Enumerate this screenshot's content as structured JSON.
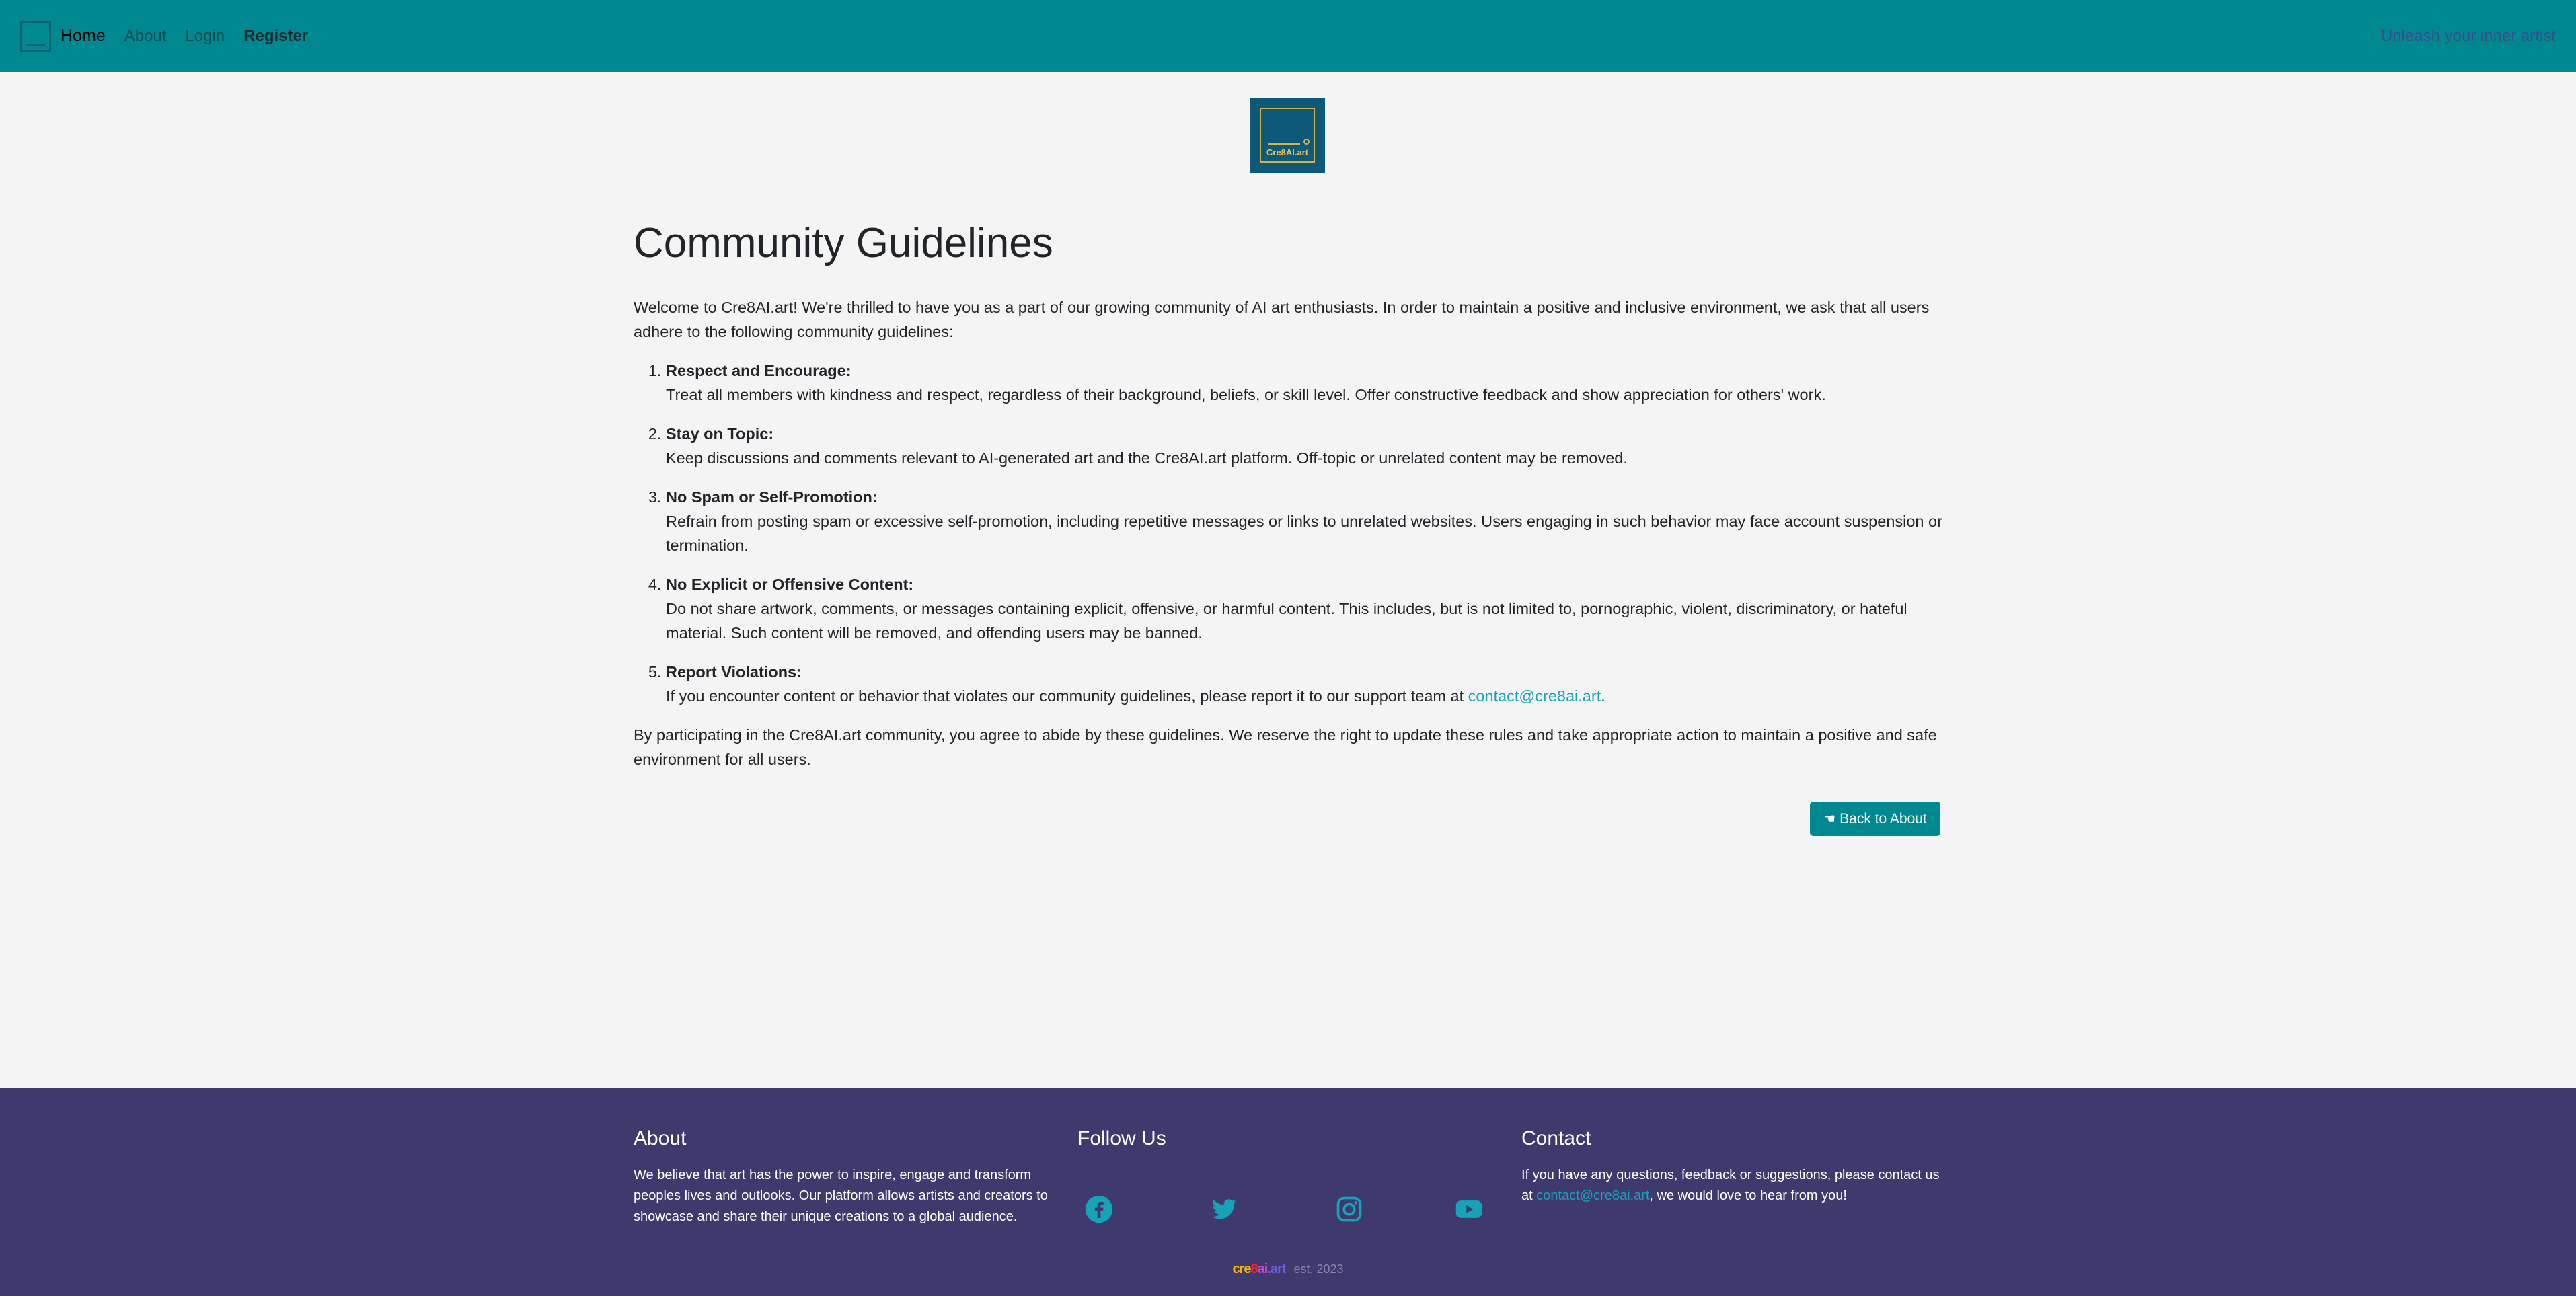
{
  "nav": {
    "home": "Home",
    "about": "About",
    "login": "Login",
    "register": "Register",
    "tagline": "Unleash your inner artist"
  },
  "brand": {
    "logo_text": "Cre8AI.art"
  },
  "main": {
    "title": "Community Guidelines",
    "intro": "Welcome to Cre8AI.art! We're thrilled to have you as a part of our growing community of AI art enthusiasts. In order to maintain a positive and inclusive environment, we ask that all users adhere to the following community guidelines:",
    "guidelines": [
      {
        "title": "Respect and Encourage:",
        "text": "Treat all members with kindness and respect, regardless of their background, beliefs, or skill level. Offer constructive feedback and show appreciation for others' work."
      },
      {
        "title": "Stay on Topic:",
        "text": "Keep discussions and comments relevant to AI-generated art and the Cre8AI.art platform. Off-topic or unrelated content may be removed."
      },
      {
        "title": "No Spam or Self-Promotion:",
        "text": "Refrain from posting spam or excessive self-promotion, including repetitive messages or links to unrelated websites. Users engaging in such behavior may face account suspension or termination."
      },
      {
        "title": "No Explicit or Offensive Content:",
        "text": "Do not share artwork, comments, or messages containing explicit, offensive, or harmful content. This includes, but is not limited to, pornographic, violent, discriminatory, or hateful material. Such content will be removed, and offending users may be banned."
      },
      {
        "title": "Report Violations:",
        "text": "If you encounter content or behavior that violates our community guidelines, please report it to our support team at ",
        "link": "contact@cre8ai.art",
        "after": "."
      }
    ],
    "closing": "By participating in the Cre8AI.art community, you agree to abide by these guidelines. We reserve the right to update these rules and take appropriate action to maintain a positive and safe environment for all users.",
    "back_button": "Back to About"
  },
  "footer": {
    "about_title": "About",
    "about_text": "We believe that art has the power to inspire, engage and transform peoples lives and outlooks. Our platform allows artists and creators to showcase and share their unique creations to a global audience.",
    "follow_title": "Follow Us",
    "social_icons": [
      "facebook-icon",
      "twitter-icon",
      "instagram-icon",
      "youtube-icon"
    ],
    "social_color": "#17a2b8",
    "contact_title": "Contact",
    "contact_before": "If you have any questions, feedback or suggestions, please contact us at ",
    "contact_link": "contact@cre8ai.art",
    "contact_after": ", we would love to hear from you!",
    "logo_word": "cre8ai.art",
    "est": "est. 2023"
  }
}
